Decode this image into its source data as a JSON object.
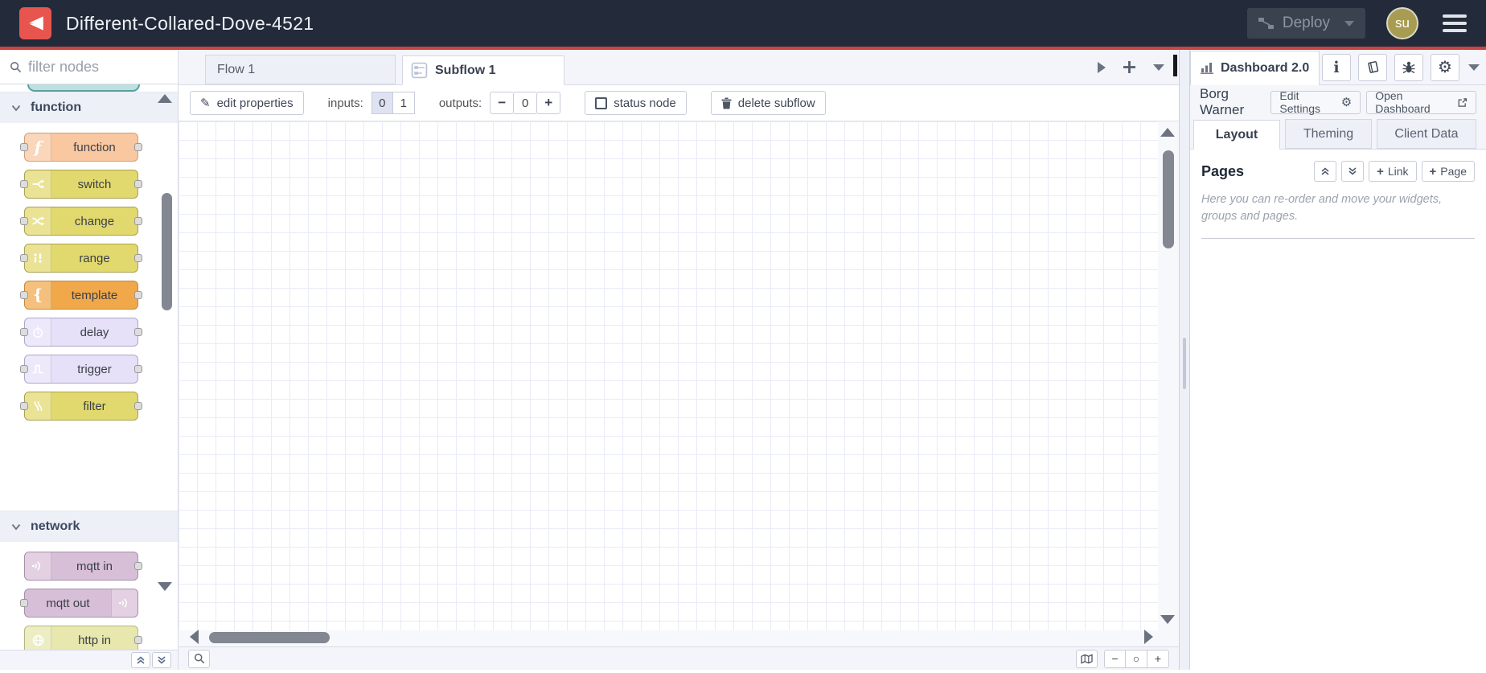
{
  "header": {
    "title": "Different-Collared-Dove-4521",
    "deploy": {
      "label": "Deploy"
    },
    "avatar": {
      "initials": "su"
    }
  },
  "colors": {
    "header_background": "#232b3a",
    "accent_red": "#cc4343",
    "logo_red": "#e8544e",
    "avatar_background": "#a79c51",
    "node_function": "#f9c7a0",
    "node_yellow": "#e2d96e",
    "node_template": "#f1a84b",
    "node_lavender": "#e6e0f8",
    "node_mqtt": "#d8bfd8",
    "node_http": "#e7e7ae"
  },
  "icons": {
    "function_glyph": "f",
    "template_glyph": "{",
    "info_glyph": "i",
    "gear_glyph": "⚙",
    "pencil_glyph": "✎"
  },
  "palette": {
    "search": {
      "placeholder": "filter nodes"
    },
    "categories": [
      {
        "label": "function",
        "nodes": [
          {
            "label": "function",
            "color": "#f9c7a0",
            "icon": "function-icon",
            "ports": "both"
          },
          {
            "label": "switch",
            "color": "#e2d96e",
            "icon": "switch-icon",
            "ports": "both"
          },
          {
            "label": "change",
            "color": "#e2d96e",
            "icon": "change-icon",
            "ports": "both"
          },
          {
            "label": "range",
            "color": "#e2d96e",
            "icon": "range-icon",
            "ports": "both"
          },
          {
            "label": "template",
            "color": "#f1a84b",
            "icon": "template-icon",
            "ports": "both"
          },
          {
            "label": "delay",
            "color": "#e6e0f8",
            "icon": "clock-icon",
            "ports": "both"
          },
          {
            "label": "trigger",
            "color": "#e6e0f8",
            "icon": "pulse-icon",
            "ports": "both"
          },
          {
            "label": "filter",
            "color": "#e2d96e",
            "icon": "filter-icon",
            "ports": "both"
          }
        ]
      },
      {
        "label": "network",
        "nodes": [
          {
            "label": "mqtt in",
            "color": "#d8bfd8",
            "icon": "wifi-icon",
            "ports": "out"
          },
          {
            "label": "mqtt out",
            "color": "#d8bfd8",
            "icon": "wifi-icon",
            "ports": "in"
          },
          {
            "label": "http in",
            "color": "#e7e7ae",
            "icon": "globe-icon",
            "ports": "out"
          }
        ]
      }
    ]
  },
  "workspace": {
    "tabs": [
      {
        "label": "Flow 1",
        "active": false
      },
      {
        "label": "Subflow 1",
        "active": true
      }
    ],
    "toolbar": {
      "edit_properties": "edit properties",
      "inputs_label": "inputs:",
      "inputs_options": [
        "0",
        "1"
      ],
      "inputs_selected": "0",
      "outputs_label": "outputs:",
      "outputs_value": "0",
      "minus": "−",
      "plus": "+",
      "status_node": "status node",
      "delete_subflow": "delete subflow"
    },
    "zoom_controls": {
      "zoom_out": "−",
      "zoom_reset": "○",
      "zoom_in": "+"
    }
  },
  "sidebar": {
    "active_tab": "Dashboard 2.0",
    "instance": {
      "name": "Borg Warner",
      "edit_settings": "Edit Settings",
      "open_dashboard": "Open Dashboard"
    },
    "tabs": [
      {
        "label": "Layout",
        "active": true
      },
      {
        "label": "Theming",
        "active": false
      },
      {
        "label": "Client Data",
        "active": false
      }
    ],
    "pages": {
      "title": "Pages",
      "plus_glyph": "+",
      "add_link": "Link",
      "add_page": "Page",
      "help_text": "Here you can re-order and move your widgets, groups and pages."
    }
  }
}
